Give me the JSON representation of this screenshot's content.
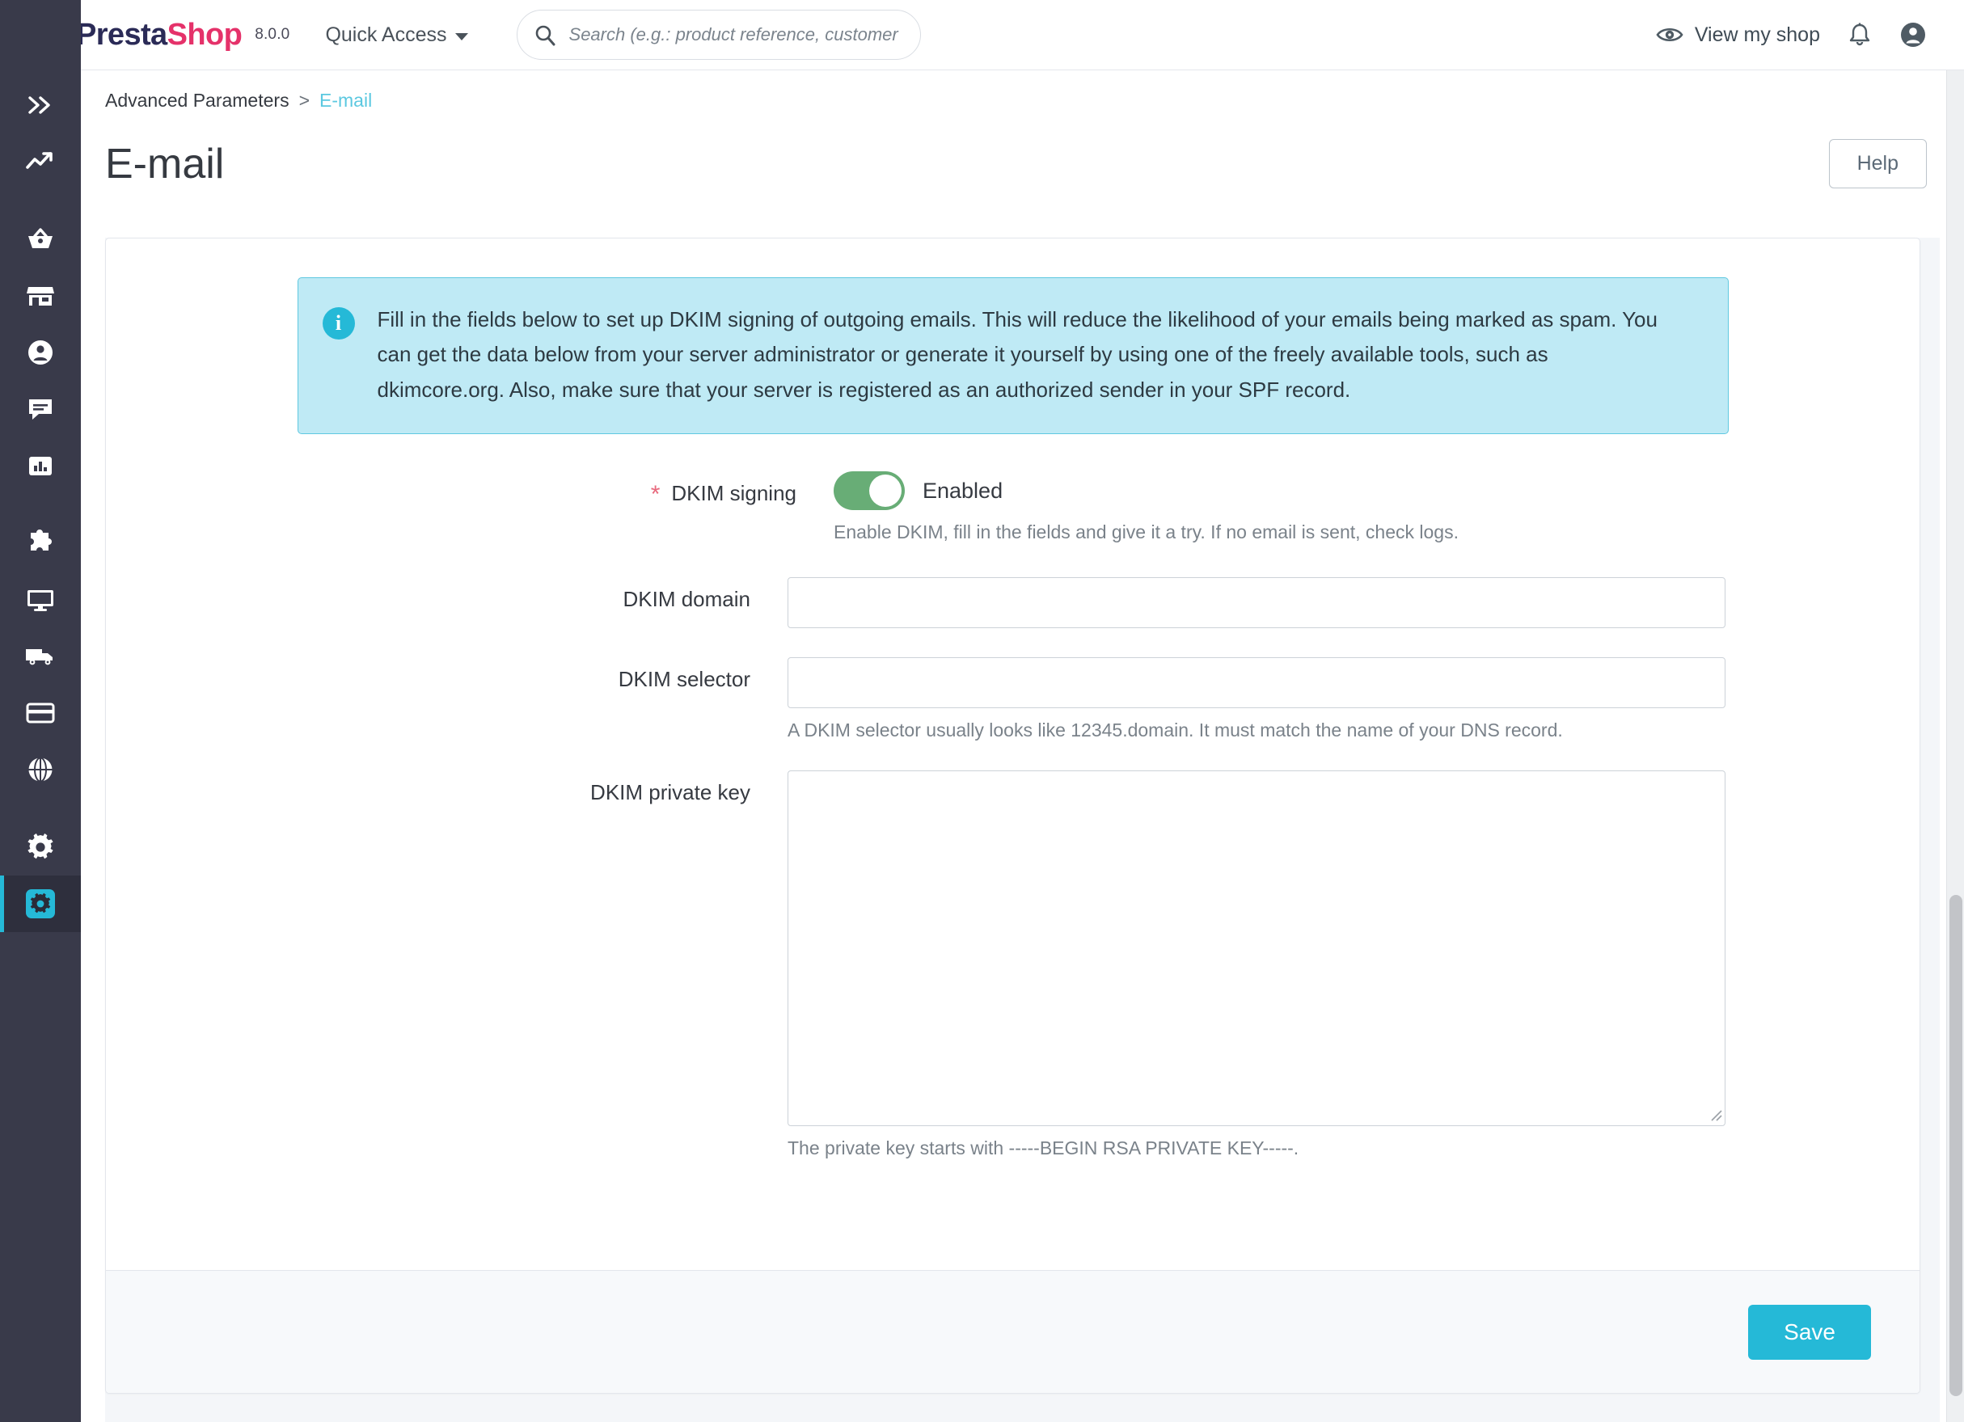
{
  "header": {
    "brand_presta": "Presta",
    "brand_shop": "Shop",
    "version": "8.0.0",
    "quick_access_label": "Quick Access",
    "search_placeholder": "Search (e.g.: product reference, customer email...)",
    "search_value": "",
    "view_shop_label": "View my shop",
    "colors": {
      "brand_pink": "#e5326a",
      "brand_navy": "#2b2b57"
    }
  },
  "sidebar": {
    "items": [
      {
        "name": "expand-menu",
        "icon": "chevrons-right-icon",
        "active": false
      },
      {
        "name": "dashboard",
        "icon": "trending-up-icon",
        "active": false
      },
      {
        "name": "orders",
        "icon": "shopping-basket-icon",
        "active": false
      },
      {
        "name": "catalog",
        "icon": "store-icon",
        "active": false
      },
      {
        "name": "customers",
        "icon": "person-circle-icon",
        "active": false
      },
      {
        "name": "customer-service",
        "icon": "chat-bubble-icon",
        "active": false
      },
      {
        "name": "stats",
        "icon": "bar-chart-icon",
        "active": false
      },
      {
        "name": "modules",
        "icon": "puzzle-piece-icon",
        "active": false
      },
      {
        "name": "design",
        "icon": "monitor-icon",
        "active": false
      },
      {
        "name": "shipping",
        "icon": "truck-icon",
        "active": false
      },
      {
        "name": "payment",
        "icon": "credit-card-icon",
        "active": false
      },
      {
        "name": "international",
        "icon": "globe-icon",
        "active": false
      },
      {
        "name": "shop-parameters",
        "icon": "gear-icon",
        "active": false
      },
      {
        "name": "advanced-parameters",
        "icon": "gear-square-icon",
        "active": true
      }
    ],
    "active_accent": "#25b9d7"
  },
  "breadcrumb": {
    "parent": "Advanced Parameters",
    "separator": ">",
    "current": "E-mail"
  },
  "page": {
    "title": "E-mail",
    "help_label": "Help"
  },
  "alert": {
    "icon": "info-icon",
    "text": "Fill in the fields below to set up DKIM signing of outgoing emails. This will reduce the likelihood of your emails being marked as spam. You can get the data below from your server administrator or generate it yourself by using one of the freely available tools, such as dkimcore.org. Also, make sure that your server is registered as an authorized sender in your SPF record.",
    "background": "#bfeaf5",
    "border": "#5fc8e0"
  },
  "form": {
    "dkim_signing": {
      "label": "DKIM signing",
      "required_marker": "*",
      "toggle_state": "on",
      "toggle_label": "Enabled",
      "toggle_color": "#68ad76",
      "help": "Enable DKIM, fill in the fields and give it a try. If no email is sent, check logs."
    },
    "dkim_domain": {
      "label": "DKIM domain",
      "value": "",
      "placeholder": ""
    },
    "dkim_selector": {
      "label": "DKIM selector",
      "value": "",
      "placeholder": "",
      "help": "A DKIM selector usually looks like 12345.domain. It must match the name of your DNS record."
    },
    "dkim_private_key": {
      "label": "DKIM private key",
      "value": "",
      "placeholder": "",
      "help": "The private key starts with -----BEGIN RSA PRIVATE KEY-----."
    }
  },
  "footer": {
    "save_label": "Save",
    "save_color": "#25b9d7"
  }
}
